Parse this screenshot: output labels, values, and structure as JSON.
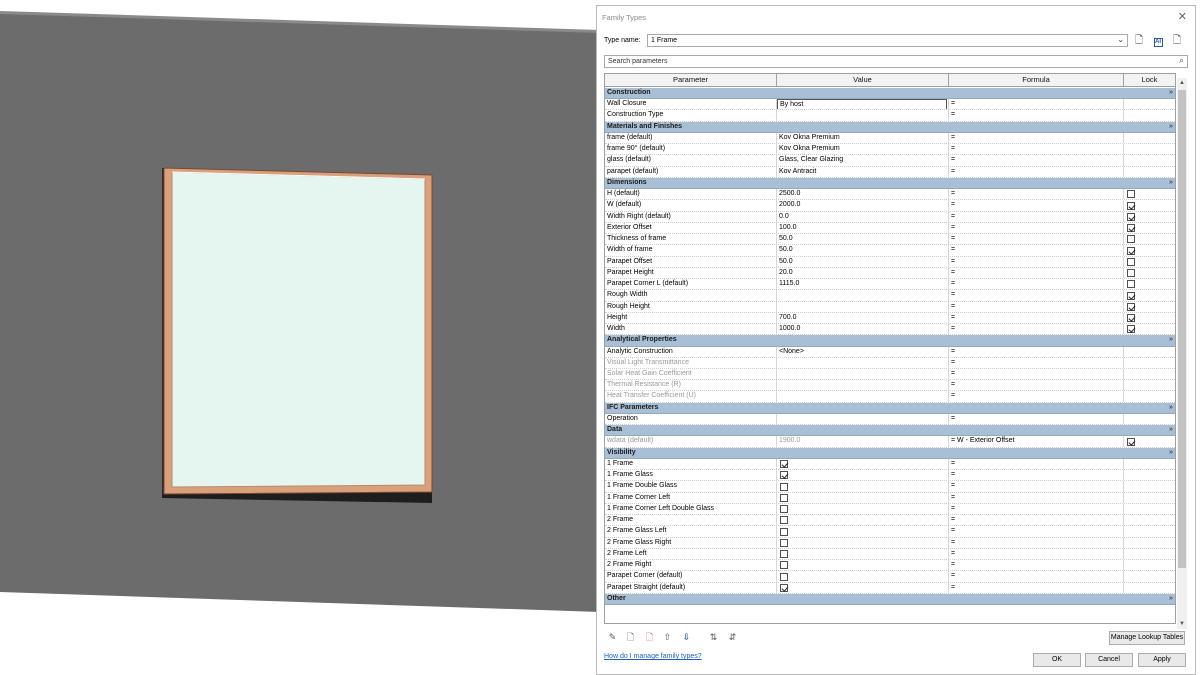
{
  "dialog": {
    "title": "Family Types",
    "close_glyph": "✕",
    "type_name_label": "Type name:",
    "type_name_value": "1 Frame",
    "search_placeholder": "Search parameters",
    "toolbar_icons": [
      "new-type-icon",
      "rename-type-icon",
      "delete-type-icon"
    ],
    "columns": [
      "Parameter",
      "Value",
      "Formula",
      "Lock"
    ],
    "rows": [
      {
        "kind": "group",
        "name": "Construction"
      },
      {
        "kind": "param",
        "param": "Wall Closure",
        "value": "By host",
        "formula": "=",
        "editing": true
      },
      {
        "kind": "param",
        "param": "Construction Type",
        "value": "",
        "formula": "="
      },
      {
        "kind": "group",
        "name": "Materials and Finishes"
      },
      {
        "kind": "param",
        "param": "frame (default)",
        "value": "Kov Okna Premium",
        "formula": "="
      },
      {
        "kind": "param",
        "param": "frame 90° (default)",
        "value": "Kov Okna Premium",
        "formula": "="
      },
      {
        "kind": "param",
        "param": "glass (default)",
        "value": "Glass, Clear Glazing",
        "formula": "="
      },
      {
        "kind": "param",
        "param": "parapet (default)",
        "value": "Kov Antracit",
        "formula": "="
      },
      {
        "kind": "group",
        "name": "Dimensions"
      },
      {
        "kind": "param",
        "param": "H (default)",
        "value": "2500.0",
        "formula": "=",
        "lock": false
      },
      {
        "kind": "param",
        "param": "W (default)",
        "value": "2000.0",
        "formula": "=",
        "lock": true
      },
      {
        "kind": "param",
        "param": "Width Right (default)",
        "value": "0.0",
        "formula": "=",
        "lock": true
      },
      {
        "kind": "param",
        "param": "Exterior Offset",
        "value": "100.0",
        "formula": "=",
        "lock": true
      },
      {
        "kind": "param",
        "param": "Thickness of frame",
        "value": "50.0",
        "formula": "=",
        "lock": false
      },
      {
        "kind": "param",
        "param": "Width of frame",
        "value": "50.0",
        "formula": "=",
        "lock": true
      },
      {
        "kind": "param",
        "param": "Parapet Offset",
        "value": "50.0",
        "formula": "=",
        "lock": false
      },
      {
        "kind": "param",
        "param": "Parapet Height",
        "value": "20.0",
        "formula": "=",
        "lock": false
      },
      {
        "kind": "param",
        "param": "Parapet Corner L (default)",
        "value": "1115.0",
        "formula": "=",
        "lock": false
      },
      {
        "kind": "param",
        "param": "Rough Width",
        "value": "",
        "formula": "=",
        "lock": true
      },
      {
        "kind": "param",
        "param": "Rough Height",
        "value": "",
        "formula": "=",
        "lock": true
      },
      {
        "kind": "param",
        "param": "Height",
        "value": "700.0",
        "formula": "=",
        "lock": true
      },
      {
        "kind": "param",
        "param": "Width",
        "value": "1000.0",
        "formula": "=",
        "lock": true
      },
      {
        "kind": "group",
        "name": "Analytical Properties"
      },
      {
        "kind": "param",
        "param": "Analytic Construction",
        "value": "<None>",
        "formula": "="
      },
      {
        "kind": "param",
        "param": "Visual Light Transmittance",
        "value": "",
        "formula": "=",
        "grey": true
      },
      {
        "kind": "param",
        "param": "Solar Heat Gain Coefficient",
        "value": "",
        "formula": "=",
        "grey": true
      },
      {
        "kind": "param",
        "param": "Thermal Resistance (R)",
        "value": "",
        "formula": "=",
        "grey": true
      },
      {
        "kind": "param",
        "param": "Heat Transfer Coefficient (U)",
        "value": "",
        "formula": "=",
        "grey": true
      },
      {
        "kind": "group",
        "name": "IFC Parameters"
      },
      {
        "kind": "param",
        "param": "Operation",
        "value": "",
        "formula": "="
      },
      {
        "kind": "group",
        "name": "Data"
      },
      {
        "kind": "param",
        "param": "wdata (default)",
        "value": "1900.0",
        "formula": "= W - Exterior Offset",
        "lock": true,
        "grey": true
      },
      {
        "kind": "group",
        "name": "Visibility"
      },
      {
        "kind": "check",
        "param": "1 Frame",
        "checked": true,
        "formula": "="
      },
      {
        "kind": "check",
        "param": "1 Frame Glass",
        "checked": true,
        "formula": "="
      },
      {
        "kind": "check",
        "param": "1 Frame Double Glass",
        "checked": false,
        "formula": "="
      },
      {
        "kind": "check",
        "param": "1 Frame Corner Left",
        "checked": false,
        "formula": "="
      },
      {
        "kind": "check",
        "param": "1 Frame Corner Left Double Glass",
        "checked": false,
        "formula": "="
      },
      {
        "kind": "check",
        "param": "2 Frame",
        "checked": false,
        "formula": "="
      },
      {
        "kind": "check",
        "param": "2 Frame Glass Left",
        "checked": false,
        "formula": "="
      },
      {
        "kind": "check",
        "param": "2 Frame Glass Right",
        "checked": false,
        "formula": "="
      },
      {
        "kind": "check",
        "param": "2 Frame Left",
        "checked": false,
        "formula": "="
      },
      {
        "kind": "check",
        "param": "2 Frame Right",
        "checked": false,
        "formula": "="
      },
      {
        "kind": "check",
        "param": "Parapet Corner (default)",
        "checked": false,
        "formula": "="
      },
      {
        "kind": "check",
        "param": "Parapet Straight (default)",
        "checked": true,
        "formula": "="
      },
      {
        "kind": "group",
        "name": "Other"
      }
    ],
    "group_toggle": "»",
    "bottom_icons": [
      "edit-pencil-icon",
      "new-parameter-icon",
      "delete-parameter-icon",
      "move-up-icon",
      "move-down-icon",
      "sort-ascending-icon",
      "sort-descending-icon"
    ],
    "manage_lookup_label": "Manage Lookup Tables",
    "help_link": "How do I manage family types?",
    "ok_label": "OK",
    "cancel_label": "Cancel",
    "apply_label": "Apply"
  },
  "colors": {
    "group_header": "#a8bfd6",
    "wall": "#6c6c6c",
    "frame": "#d9a07c",
    "glass": "#e4f6ef",
    "link": "#1f5fb5"
  }
}
